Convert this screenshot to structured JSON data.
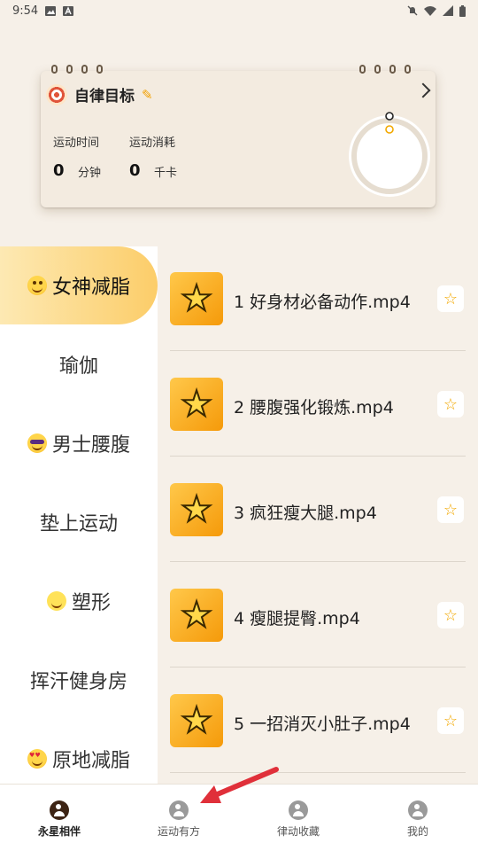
{
  "status_bar": {
    "time": "9:54",
    "icons": [
      "image-icon",
      "a-icon",
      "mute-icon",
      "wifi-icon",
      "signal-icon",
      "battery-icon"
    ]
  },
  "goal_card": {
    "title": "自律目标",
    "stats": [
      {
        "label": "运动时间",
        "value": "0",
        "unit": "分钟"
      },
      {
        "label": "运动消耗",
        "value": "0",
        "unit": "千卡"
      }
    ],
    "progress": 0,
    "icons": [
      "target-icon",
      "pencil-icon",
      "chevron-right-icon"
    ]
  },
  "categories": [
    {
      "label": "女神减脂",
      "icon": "tongue-face-emoji",
      "active": true
    },
    {
      "label": "瑜伽",
      "icon": "",
      "active": false
    },
    {
      "label": "男士腰腹",
      "icon": "sunglasses-face-emoji",
      "active": false
    },
    {
      "label": "垫上运动",
      "icon": "",
      "active": false
    },
    {
      "label": "塑形",
      "icon": "chick-emoji",
      "active": false
    },
    {
      "label": "挥汗健身房",
      "icon": "",
      "active": false
    },
    {
      "label": "原地减脂",
      "icon": "heart-eyes-face-emoji",
      "active": false
    }
  ],
  "videos": [
    {
      "title": "1 好身材必备动作.mp4"
    },
    {
      "title": "2 腰腹强化锻炼.mp4"
    },
    {
      "title": "3 疯狂瘦大腿.mp4"
    },
    {
      "title": "4 瘦腿提臀.mp4"
    },
    {
      "title": "5 一招消灭小肚子.mp4"
    }
  ],
  "bottom_nav": [
    {
      "label": "永星相伴",
      "icon": "runner-icon",
      "active": true
    },
    {
      "label": "运动有方",
      "icon": "exercise-icon",
      "active": false
    },
    {
      "label": "律动收藏",
      "icon": "dance-icon",
      "active": false
    },
    {
      "label": "我的",
      "icon": "profile-icon",
      "active": false
    }
  ],
  "colors": {
    "accent": "#fccd69",
    "background": "#f6f0e8",
    "annotation_arrow": "#e0303a"
  }
}
